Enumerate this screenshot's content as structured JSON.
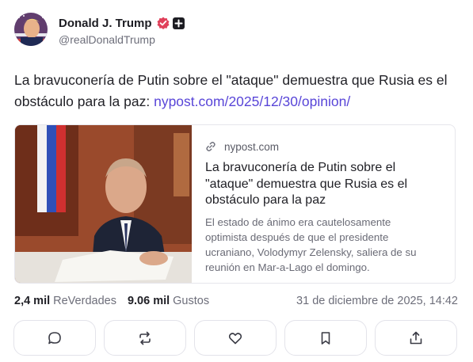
{
  "author": {
    "display_name": "Donald J. Trump",
    "handle": "@realDonaldTrump",
    "verified_icon": "verified-badge-icon",
    "plus_icon": "plus-badge-icon",
    "verified_color": "#e0405a"
  },
  "post": {
    "text": "La bravuconería de Putin sobre el \"ataque\" demuestra que Rusia es el obstáculo para la paz: ",
    "link_text": "nypost.com/2025/12/30/opinion/",
    "link_color": "#5845d8"
  },
  "card": {
    "domain": "nypost.com",
    "title": "La bravuconería de Putin sobre el \"ataque\" demuestra que Rusia es el obstáculo para la paz",
    "description": "El estado de ánimo era cautelosamente optimista después de que el presidente ucraniano, Volodymyr Zelensky, saliera de su reunión en Mar-a-Lago el domingo."
  },
  "stats": {
    "retruths_count": "2,4 mil",
    "retruths_label": "ReVerdades",
    "likes_count": "9.06 mil",
    "likes_label": "Gustos",
    "timestamp": "31 de diciembre de 2025, 14:42"
  },
  "actions": [
    {
      "icon": "reply-icon"
    },
    {
      "icon": "repost-icon"
    },
    {
      "icon": "like-icon"
    },
    {
      "icon": "bookmark-icon"
    },
    {
      "icon": "share-icon"
    }
  ]
}
